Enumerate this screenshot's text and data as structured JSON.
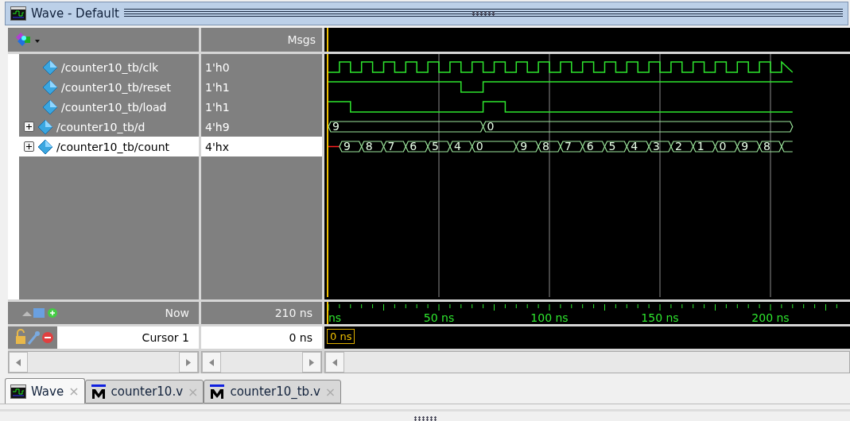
{
  "window": {
    "title": "Wave - Default"
  },
  "header": {
    "values_title": "Msgs"
  },
  "signals": [
    {
      "name": "/counter10_tb/clk",
      "value": "1'h0",
      "kind": "bit",
      "selected": false
    },
    {
      "name": "/counter10_tb/reset",
      "value": "1'h1",
      "kind": "bit",
      "selected": false
    },
    {
      "name": "/counter10_tb/load",
      "value": "1'h1",
      "kind": "bit",
      "selected": false
    },
    {
      "name": "/counter10_tb/d",
      "value": "4'h9",
      "kind": "bus",
      "selected": false,
      "wave": [
        "9",
        "0"
      ]
    },
    {
      "name": "/counter10_tb/count",
      "value": "4'hx",
      "kind": "bus",
      "selected": true,
      "wave": [
        "9",
        "8",
        "7",
        "6",
        "5",
        "4",
        "0",
        "9",
        "8",
        "7",
        "6",
        "5",
        "4",
        "3",
        "2",
        "1",
        "0",
        "9",
        "8"
      ]
    }
  ],
  "now": {
    "label": "Now",
    "value": "210 ns"
  },
  "cursor": {
    "label": "Cursor 1",
    "value": "0 ns",
    "marker": "0 ns"
  },
  "timeline": [
    "ns",
    "50 ns",
    "100 ns",
    "150 ns",
    "200 ns"
  ],
  "tabs": [
    {
      "label": "Wave",
      "selected": true,
      "close": "×"
    },
    {
      "label": "counter10.v",
      "selected": false,
      "close": "×"
    },
    {
      "label": "counter10_tb.v",
      "selected": false,
      "close": "×"
    }
  ]
}
